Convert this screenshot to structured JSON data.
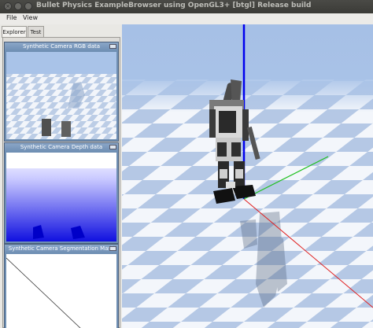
{
  "window": {
    "title": "Bullet Physics ExampleBrowser using OpenGL3+ [btgl] Release build"
  },
  "menu": [
    "File",
    "View"
  ],
  "tabs": [
    "Explorer",
    "Test"
  ],
  "subviews": {
    "rgb": "Synthetic Camera RGB data",
    "depth": "Synthetic Camera Depth data",
    "segmentation": "Synthetic Camera Segmentation Mask"
  },
  "colors": {
    "sky": "#a9c3e8",
    "checker_light": "#f4f6fb",
    "checker_dark": "#b7c9e4",
    "axis_z": "#0000ee",
    "axis_x": "#e02020",
    "axis_y": "#20c020"
  }
}
